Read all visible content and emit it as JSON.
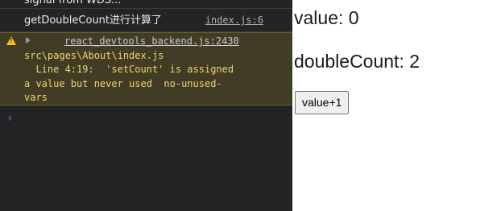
{
  "console": {
    "cut_line": "signal from WDS...",
    "log": {
      "message": "getDoubleCount进行计算了",
      "source": "index.js:6"
    },
    "warning": {
      "icon": "warning-icon",
      "source": "react_devtools_backend.js:2430",
      "text": "src\\pages\\About\\index.js\n  Line 4:19:  'setCount' is assigned\na value but never used  no-unused-\nvars"
    },
    "prompt_symbol": "›"
  },
  "app": {
    "value_label": "value: 0",
    "double_count_label": "doubleCount: 2",
    "increment_button": "value+1"
  },
  "colors": {
    "console_bg": "#242424",
    "warning_bg": "#413c25",
    "warning_text": "#f2d36f",
    "prompt": "#3d8bfd"
  }
}
